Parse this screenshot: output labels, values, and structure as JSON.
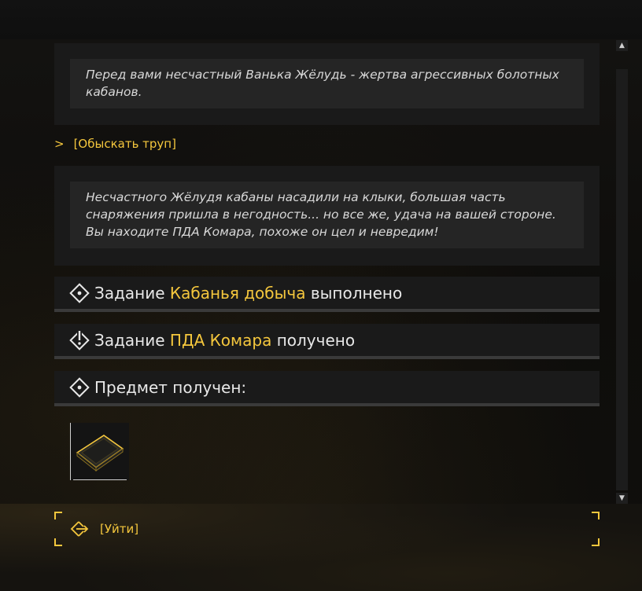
{
  "dialog": {
    "text1": "Перед вами несчастный Ванька Жёлудь - жертва агрессивных болотных кабанов.",
    "choice_arrow": ">",
    "choice_label": "[Обыскать труп]",
    "text2": "Несчастного Жёлудя кабаны насадили на клыки, большая часть снаряжения пришла в негодность... но все же, удача на вашей стороне. Вы находите ПДА Комара, похоже он цел и невредим!"
  },
  "notifications": [
    {
      "prefix": "Задание",
      "highlight": "Кабанья добыча",
      "suffix": "выполнено",
      "icon": "quest-complete-icon"
    },
    {
      "prefix": "Задание",
      "highlight": "ПДА Комара",
      "suffix": "получено",
      "icon": "quest-new-icon"
    },
    {
      "prefix": "Предмет получен:",
      "icon": "item-received-icon"
    }
  ],
  "reward": {
    "icon": "pda-item-icon"
  },
  "leave": {
    "label": "[Уйти]",
    "icon": "exit-icon"
  },
  "colors": {
    "accent": "#f5c73d",
    "panel": "#1a1a1a",
    "quote": "#252525"
  }
}
